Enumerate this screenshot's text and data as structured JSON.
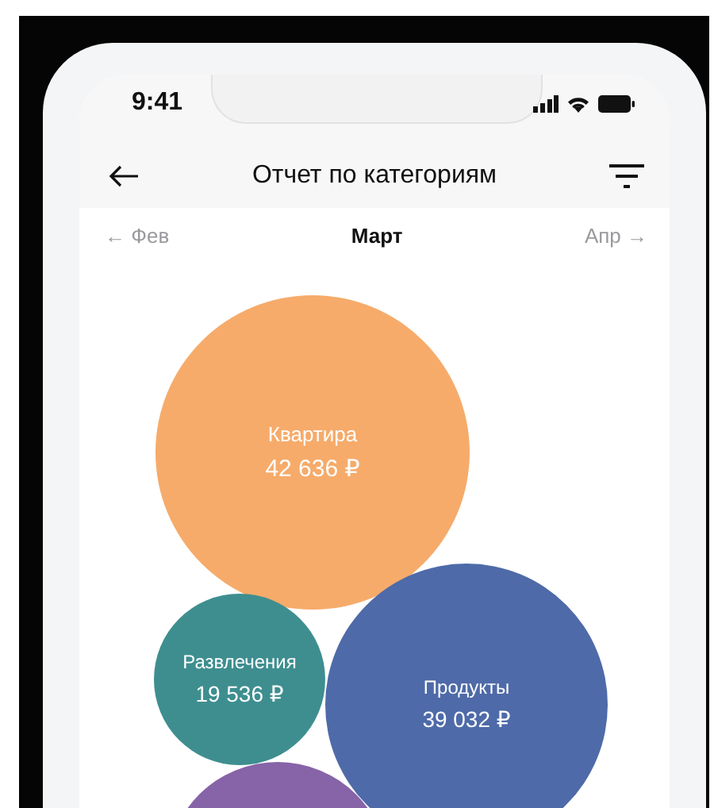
{
  "status_bar": {
    "time": "9:41"
  },
  "header": {
    "title": "Отчет по категориям"
  },
  "month_nav": {
    "previous": "← Фев",
    "current": "Март",
    "next": "Апр →"
  },
  "bubbles": [
    {
      "label": "Квартира",
      "amount": "42 636 ₽",
      "color": "#f6ab6a"
    },
    {
      "label": "Развлечения",
      "amount": "19 536 ₽",
      "color": "#3e8e90"
    },
    {
      "label": "Продукты",
      "amount": "39 032 ₽",
      "color": "#4e6aa8"
    },
    {
      "color": "#8763a8"
    }
  ]
}
